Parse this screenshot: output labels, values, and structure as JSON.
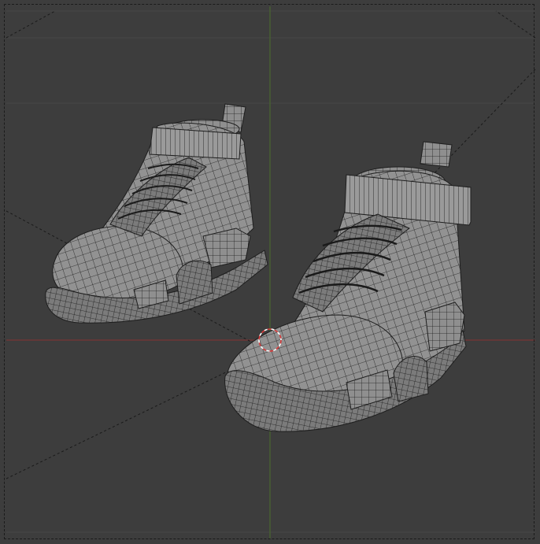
{
  "viewport": {
    "mode": "3d-viewport-wireframe-overlay",
    "background_color": "#3d3d3d",
    "grid_color": "#474747",
    "x_axis_color": "#8a3a3a",
    "y_axis_color": "#4a6a2a",
    "mesh_fill_color": "#8f8f8f",
    "mesh_wire_color": "#1e1e1e",
    "cursor_color": "#d83a3a",
    "icons": {
      "object_1": "shoe-mesh-icon",
      "object_2": "shoe-mesh-icon",
      "cursor": "3d-cursor-icon"
    }
  }
}
